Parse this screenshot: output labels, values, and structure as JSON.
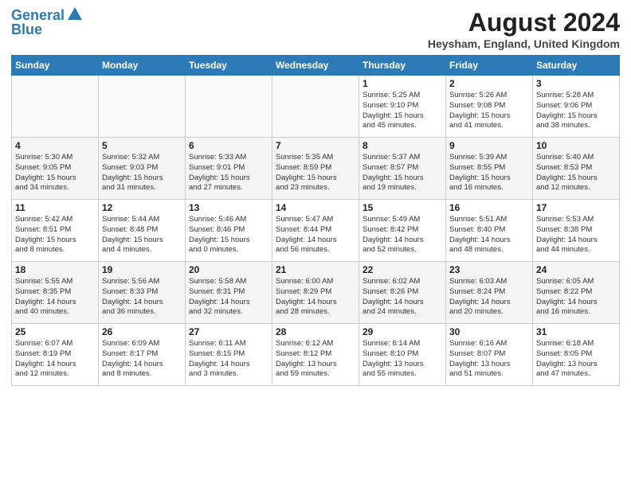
{
  "header": {
    "logo_line1": "General",
    "logo_line2": "Blue",
    "main_title": "August 2024",
    "subtitle": "Heysham, England, United Kingdom"
  },
  "weekdays": [
    "Sunday",
    "Monday",
    "Tuesday",
    "Wednesday",
    "Thursday",
    "Friday",
    "Saturday"
  ],
  "weeks": [
    [
      {
        "day": "",
        "info": ""
      },
      {
        "day": "",
        "info": ""
      },
      {
        "day": "",
        "info": ""
      },
      {
        "day": "",
        "info": ""
      },
      {
        "day": "1",
        "info": "Sunrise: 5:25 AM\nSunset: 9:10 PM\nDaylight: 15 hours\nand 45 minutes."
      },
      {
        "day": "2",
        "info": "Sunrise: 5:26 AM\nSunset: 9:08 PM\nDaylight: 15 hours\nand 41 minutes."
      },
      {
        "day": "3",
        "info": "Sunrise: 5:28 AM\nSunset: 9:06 PM\nDaylight: 15 hours\nand 38 minutes."
      }
    ],
    [
      {
        "day": "4",
        "info": "Sunrise: 5:30 AM\nSunset: 9:05 PM\nDaylight: 15 hours\nand 34 minutes."
      },
      {
        "day": "5",
        "info": "Sunrise: 5:32 AM\nSunset: 9:03 PM\nDaylight: 15 hours\nand 31 minutes."
      },
      {
        "day": "6",
        "info": "Sunrise: 5:33 AM\nSunset: 9:01 PM\nDaylight: 15 hours\nand 27 minutes."
      },
      {
        "day": "7",
        "info": "Sunrise: 5:35 AM\nSunset: 8:59 PM\nDaylight: 15 hours\nand 23 minutes."
      },
      {
        "day": "8",
        "info": "Sunrise: 5:37 AM\nSunset: 8:57 PM\nDaylight: 15 hours\nand 19 minutes."
      },
      {
        "day": "9",
        "info": "Sunrise: 5:39 AM\nSunset: 8:55 PM\nDaylight: 15 hours\nand 16 minutes."
      },
      {
        "day": "10",
        "info": "Sunrise: 5:40 AM\nSunset: 8:53 PM\nDaylight: 15 hours\nand 12 minutes."
      }
    ],
    [
      {
        "day": "11",
        "info": "Sunrise: 5:42 AM\nSunset: 8:51 PM\nDaylight: 15 hours\nand 8 minutes."
      },
      {
        "day": "12",
        "info": "Sunrise: 5:44 AM\nSunset: 8:48 PM\nDaylight: 15 hours\nand 4 minutes."
      },
      {
        "day": "13",
        "info": "Sunrise: 5:46 AM\nSunset: 8:46 PM\nDaylight: 15 hours\nand 0 minutes."
      },
      {
        "day": "14",
        "info": "Sunrise: 5:47 AM\nSunset: 8:44 PM\nDaylight: 14 hours\nand 56 minutes."
      },
      {
        "day": "15",
        "info": "Sunrise: 5:49 AM\nSunset: 8:42 PM\nDaylight: 14 hours\nand 52 minutes."
      },
      {
        "day": "16",
        "info": "Sunrise: 5:51 AM\nSunset: 8:40 PM\nDaylight: 14 hours\nand 48 minutes."
      },
      {
        "day": "17",
        "info": "Sunrise: 5:53 AM\nSunset: 8:38 PM\nDaylight: 14 hours\nand 44 minutes."
      }
    ],
    [
      {
        "day": "18",
        "info": "Sunrise: 5:55 AM\nSunset: 8:35 PM\nDaylight: 14 hours\nand 40 minutes."
      },
      {
        "day": "19",
        "info": "Sunrise: 5:56 AM\nSunset: 8:33 PM\nDaylight: 14 hours\nand 36 minutes."
      },
      {
        "day": "20",
        "info": "Sunrise: 5:58 AM\nSunset: 8:31 PM\nDaylight: 14 hours\nand 32 minutes."
      },
      {
        "day": "21",
        "info": "Sunrise: 6:00 AM\nSunset: 8:29 PM\nDaylight: 14 hours\nand 28 minutes."
      },
      {
        "day": "22",
        "info": "Sunrise: 6:02 AM\nSunset: 8:26 PM\nDaylight: 14 hours\nand 24 minutes."
      },
      {
        "day": "23",
        "info": "Sunrise: 6:03 AM\nSunset: 8:24 PM\nDaylight: 14 hours\nand 20 minutes."
      },
      {
        "day": "24",
        "info": "Sunrise: 6:05 AM\nSunset: 8:22 PM\nDaylight: 14 hours\nand 16 minutes."
      }
    ],
    [
      {
        "day": "25",
        "info": "Sunrise: 6:07 AM\nSunset: 8:19 PM\nDaylight: 14 hours\nand 12 minutes."
      },
      {
        "day": "26",
        "info": "Sunrise: 6:09 AM\nSunset: 8:17 PM\nDaylight: 14 hours\nand 8 minutes."
      },
      {
        "day": "27",
        "info": "Sunrise: 6:11 AM\nSunset: 8:15 PM\nDaylight: 14 hours\nand 3 minutes."
      },
      {
        "day": "28",
        "info": "Sunrise: 6:12 AM\nSunset: 8:12 PM\nDaylight: 13 hours\nand 59 minutes."
      },
      {
        "day": "29",
        "info": "Sunrise: 6:14 AM\nSunset: 8:10 PM\nDaylight: 13 hours\nand 55 minutes."
      },
      {
        "day": "30",
        "info": "Sunrise: 6:16 AM\nSunset: 8:07 PM\nDaylight: 13 hours\nand 51 minutes."
      },
      {
        "day": "31",
        "info": "Sunrise: 6:18 AM\nSunset: 8:05 PM\nDaylight: 13 hours\nand 47 minutes."
      }
    ]
  ]
}
